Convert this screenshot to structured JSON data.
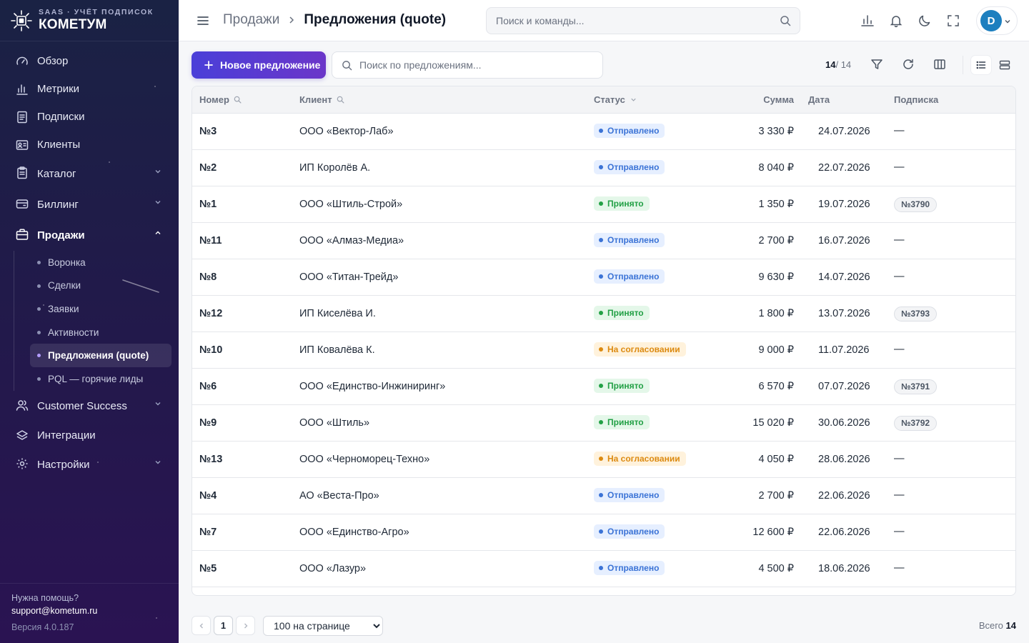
{
  "brand": {
    "subtitle": "SAAS · УЧЁТ ПОДПИСОК",
    "name": "КОМЕТУМ"
  },
  "sidebar": {
    "items": [
      {
        "label": "Обзор"
      },
      {
        "label": "Метрики"
      },
      {
        "label": "Подписки"
      },
      {
        "label": "Клиенты"
      },
      {
        "label": "Каталог"
      },
      {
        "label": "Биллинг"
      },
      {
        "label": "Продажи"
      },
      {
        "label": "Customer Success"
      },
      {
        "label": "Интеграции"
      },
      {
        "label": "Настройки"
      }
    ],
    "sales_subitems": [
      {
        "label": "Воронка"
      },
      {
        "label": "Сделки"
      },
      {
        "label": "Заявки"
      },
      {
        "label": "Активности"
      },
      {
        "label": "Предложения (quote)"
      },
      {
        "label": "PQL — горячие лиды"
      }
    ],
    "footer": {
      "help": "Нужна помощь?",
      "email": "support@kometum.ru",
      "version": "Версия 4.0.187"
    }
  },
  "header": {
    "breadcrumb_parent": "Продажи",
    "breadcrumb_current": "Предложения (quote)",
    "search_placeholder": "Поиск и команды...",
    "avatar_initial": "D"
  },
  "toolbar": {
    "new_button": "Новое предложение",
    "search_placeholder": "Поиск по предложениям...",
    "count_shown": "14",
    "count_total": "/ 14"
  },
  "table": {
    "columns": {
      "number": "Номер",
      "client": "Клиент",
      "status": "Статус",
      "sum": "Сумма",
      "date": "Дата",
      "subscription": "Подписка"
    },
    "rows": [
      {
        "number": "№3",
        "client": "ООО «Вектор-Лаб»",
        "status": "Отправлено",
        "status_type": "sent",
        "sum": "3 330 ₽",
        "date": "24.07.2026",
        "subscription": "—"
      },
      {
        "number": "№2",
        "client": "ИП Королёв А.",
        "status": "Отправлено",
        "status_type": "sent",
        "sum": "8 040 ₽",
        "date": "22.07.2026",
        "subscription": "—"
      },
      {
        "number": "№1",
        "client": "ООО «Штиль-Строй»",
        "status": "Принято",
        "status_type": "accepted",
        "sum": "1 350 ₽",
        "date": "19.07.2026",
        "subscription": "№3790"
      },
      {
        "number": "№11",
        "client": "ООО «Алмаз-Медиа»",
        "status": "Отправлено",
        "status_type": "sent",
        "sum": "2 700 ₽",
        "date": "16.07.2026",
        "subscription": "—"
      },
      {
        "number": "№8",
        "client": "ООО «Титан-Трейд»",
        "status": "Отправлено",
        "status_type": "sent",
        "sum": "9 630 ₽",
        "date": "14.07.2026",
        "subscription": "—"
      },
      {
        "number": "№12",
        "client": "ИП Киселёва И.",
        "status": "Принято",
        "status_type": "accepted",
        "sum": "1 800 ₽",
        "date": "13.07.2026",
        "subscription": "№3793"
      },
      {
        "number": "№10",
        "client": "ИП Ковалёва К.",
        "status": "На согласовании",
        "status_type": "review",
        "sum": "9 000 ₽",
        "date": "11.07.2026",
        "subscription": "—"
      },
      {
        "number": "№6",
        "client": "ООО «Единство-Инжиниринг»",
        "status": "Принято",
        "status_type": "accepted",
        "sum": "6 570 ₽",
        "date": "07.07.2026",
        "subscription": "№3791"
      },
      {
        "number": "№9",
        "client": "ООО «Штиль»",
        "status": "Принято",
        "status_type": "accepted",
        "sum": "15 020 ₽",
        "date": "30.06.2026",
        "subscription": "№3792"
      },
      {
        "number": "№13",
        "client": "ООО «Черноморец-Техно»",
        "status": "На согласовании",
        "status_type": "review",
        "sum": "4 050 ₽",
        "date": "28.06.2026",
        "subscription": "—"
      },
      {
        "number": "№4",
        "client": "АО «Веста-Про»",
        "status": "Отправлено",
        "status_type": "sent",
        "sum": "2 700 ₽",
        "date": "22.06.2026",
        "subscription": "—"
      },
      {
        "number": "№7",
        "client": "ООО «Единство-Агро»",
        "status": "Отправлено",
        "status_type": "sent",
        "sum": "12 600 ₽",
        "date": "22.06.2026",
        "subscription": "—"
      },
      {
        "number": "№5",
        "client": "ООО «Лазур»",
        "status": "Отправлено",
        "status_type": "sent",
        "sum": "4 500 ₽",
        "date": "18.06.2026",
        "subscription": "—"
      }
    ]
  },
  "pagination": {
    "page": "1",
    "per_page": "100 на странице",
    "total_label": "Всего",
    "total": "14"
  },
  "colors": {
    "accent": "#4a3fd8",
    "sent": "#3b73d6",
    "accepted": "#22a045",
    "review": "#dc8a10",
    "sidebar_bg": "#1f1c4a"
  }
}
